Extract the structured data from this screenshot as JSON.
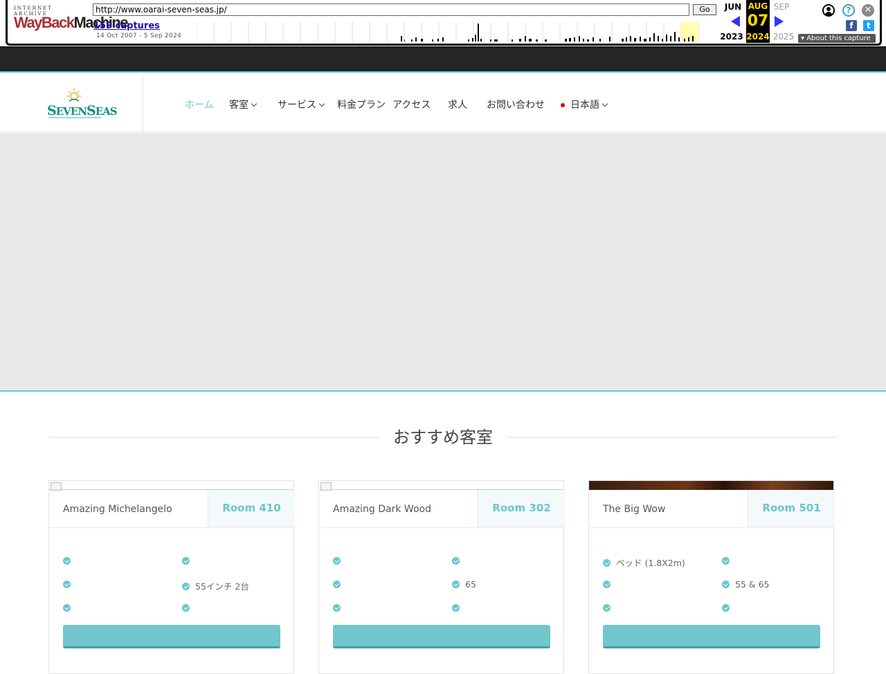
{
  "wayback": {
    "logo_top": "INTERNET ARCHIVE",
    "logo_wayback": "WayBack",
    "logo_machine": "Machine",
    "url": "http://www.oarai-seven-seas.jp/",
    "go_label": "Go",
    "captures": "159 captures",
    "range": "14 Oct 2007 - 5 Sep 2024",
    "month_prev": "JUN",
    "month_cur": "AUG",
    "month_next": "SEP",
    "day": "07",
    "year_prev": "2023",
    "year_cur": "2024",
    "year_next": "2025",
    "about": "About this capture",
    "help_glyph": "?",
    "close_glyph": "✕",
    "fb_glyph": "f",
    "tw_glyph": "t"
  },
  "site": {
    "logo_text_s": "S",
    "logo_text_even": "EVEN",
    "logo_text_s2": "S",
    "logo_text_eas": "EAS",
    "nav": [
      {
        "label": "ホーム",
        "active": true,
        "dropdown": false
      },
      {
        "label": "客室",
        "active": false,
        "dropdown": true
      },
      {
        "label": "サービス",
        "active": false,
        "dropdown": true
      },
      {
        "label": "料金プラン",
        "active": false,
        "dropdown": false
      },
      {
        "label": "アクセス",
        "active": false,
        "dropdown": false
      },
      {
        "label": "求人",
        "active": false,
        "dropdown": false
      },
      {
        "label": "お問い合わせ",
        "active": false,
        "dropdown": false
      }
    ],
    "lang": "日本語",
    "section_title": "おすすめ客室"
  },
  "rooms": [
    {
      "name": "Amazing Michelangelo",
      "room": "Room 410",
      "features": [
        "",
        "",
        "",
        "55インチ 2台",
        "",
        ""
      ]
    },
    {
      "name": "Amazing Dark Wood",
      "room": "Room 302",
      "features": [
        "",
        "",
        "",
        "65",
        "",
        ""
      ]
    },
    {
      "name": "The Big Wow",
      "room": "Room 501",
      "features": [
        "ベッド (1.8X2m)",
        "",
        "",
        "55 & 65",
        "",
        ""
      ]
    }
  ],
  "colors": {
    "accent": "#6bc5cf",
    "button": "#72c6cc",
    "dark_bar": "#262626",
    "hero": "#e8e8e8"
  }
}
